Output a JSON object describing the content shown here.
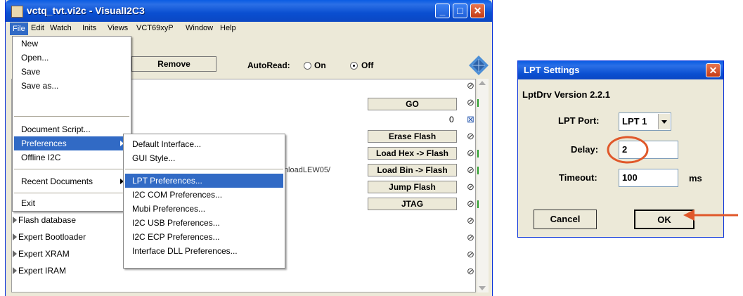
{
  "window": {
    "title": "vctq_tvt.vi2c - VisualI2C3",
    "minimize": "_",
    "maximize": "□",
    "close": "✕"
  },
  "menubar": [
    "File",
    "Edit",
    "Watch",
    "Inits",
    "Views",
    "VCT69xyP",
    "Window",
    "Help"
  ],
  "toolbar": {
    "remove_label": "Remove",
    "autoread_label": "AutoRead:",
    "on_label": "On",
    "off_label": "Off",
    "autoread_value": "Off"
  },
  "actions": [
    "GO",
    "Erase Flash",
    "Load Hex -> Flash",
    "Load Bin -> Flash",
    "Jump Flash",
    "JTAG"
  ],
  "path_fragment": "wnloadLEW05/",
  "status_zero": "0",
  "tree": [
    "Flash database",
    "Expert Bootloader",
    "Expert XRAM",
    "Expert IRAM"
  ],
  "file_menu": {
    "items": [
      "New",
      "Open...",
      "Save",
      "Save as...",
      "Document Script...",
      "Preferences",
      "Offline I2C",
      "Recent Documents",
      "Exit"
    ]
  },
  "prefs_menu": {
    "items": [
      "Default Interface...",
      "GUI Style...",
      "LPT Preferences...",
      "I2C COM Preferences...",
      "Mubi Preferences...",
      "I2C USB Preferences...",
      "I2C ECP Preferences...",
      "Interface DLL Preferences..."
    ]
  },
  "dialog": {
    "title": "LPT Settings",
    "close": "✕",
    "version": "LptDrv Version 2.2.1",
    "port_label": "LPT Port:",
    "port_value": "LPT 1",
    "delay_label": "Delay:",
    "delay_value": "2",
    "timeout_label": "Timeout:",
    "timeout_value": "100",
    "timeout_unit": "ms",
    "cancel_label": "Cancel",
    "ok_label": "OK"
  },
  "colors": {
    "titlebar": "#0a5de3",
    "highlight": "#316ac5",
    "annotation": "#e0582a"
  }
}
